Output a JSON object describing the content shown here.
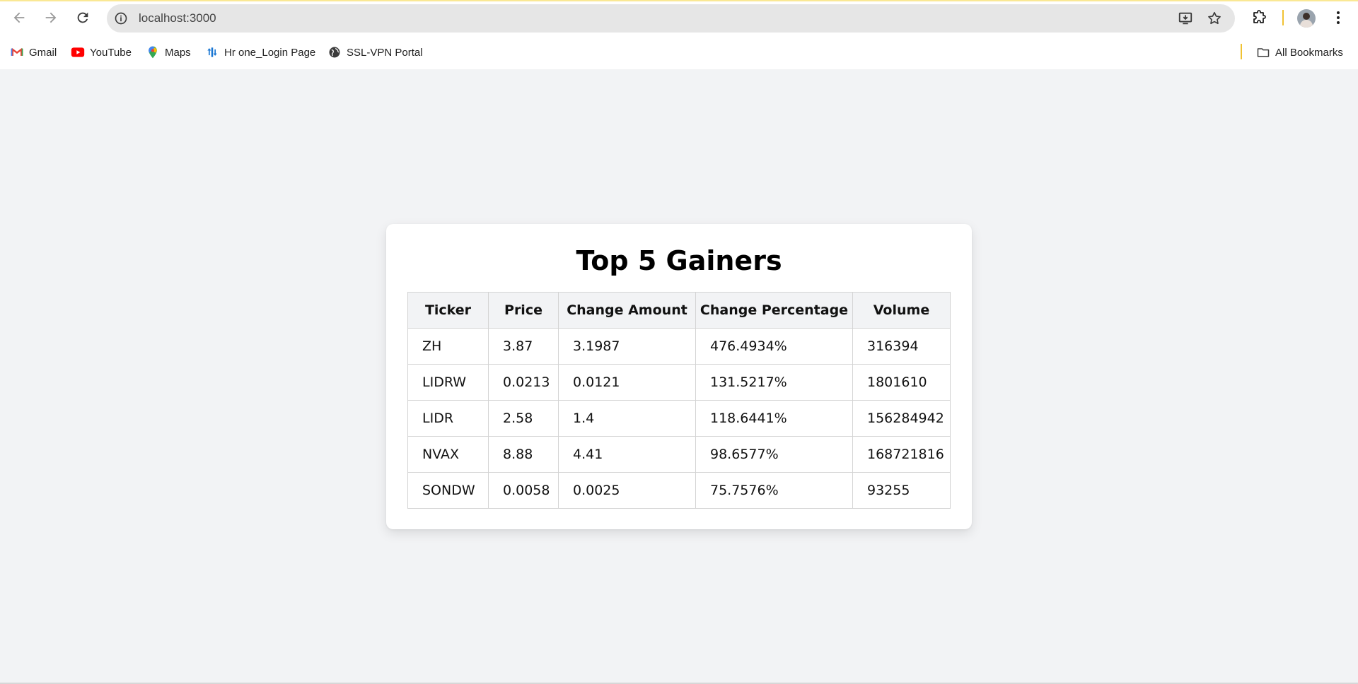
{
  "browser": {
    "url": "localhost:3000",
    "bookmarks": [
      {
        "label": "Gmail",
        "icon": "gmail-icon"
      },
      {
        "label": "YouTube",
        "icon": "youtube-icon"
      },
      {
        "label": "Maps",
        "icon": "maps-icon"
      },
      {
        "label": "Hr one_Login Page",
        "icon": "hrone-icon"
      },
      {
        "label": "SSL-VPN Portal",
        "icon": "globe-icon"
      }
    ],
    "all_bookmarks_label": "All Bookmarks"
  },
  "page": {
    "title": "Top 5 Gainers",
    "table": {
      "headers": [
        "Ticker",
        "Price",
        "Change Amount",
        "Change Percentage",
        "Volume"
      ],
      "rows": [
        [
          "ZH",
          "3.87",
          "3.1987",
          "476.4934%",
          "316394"
        ],
        [
          "LIDRW",
          "0.0213",
          "0.0121",
          "131.5217%",
          "1801610"
        ],
        [
          "LIDR",
          "2.58",
          "1.4",
          "118.6441%",
          "156284942"
        ],
        [
          "NVAX",
          "8.88",
          "4.41",
          "98.6577%",
          "168721816"
        ],
        [
          "SONDW",
          "0.0058",
          "0.0025",
          "75.7576%",
          "93255"
        ]
      ]
    }
  },
  "colors": {
    "page_background": "#f2f3f5",
    "card_background": "#ffffff",
    "header_background": "#f2f3f5",
    "border": "#d4d4d4"
  }
}
